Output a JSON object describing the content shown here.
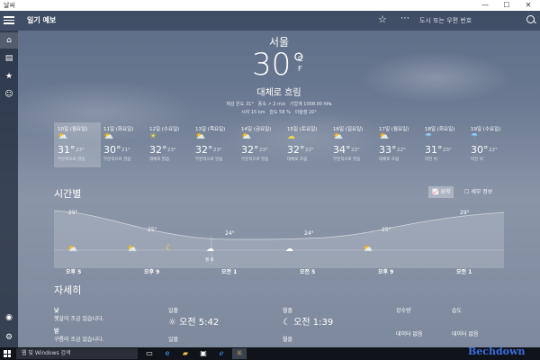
{
  "window": {
    "title": "날씨",
    "min": "—",
    "max": "☐",
    "close": "✕"
  },
  "app": {
    "title": "일기 예보",
    "search_placeholder": "도시 또는 우편 번호"
  },
  "current": {
    "city": "서울",
    "temp": "30°",
    "unit_c": "C",
    "unit_f": "F",
    "condition": "대체로 흐림",
    "feels": "체감 온도 31°",
    "wind": "풍속 ↗ 2 m/s",
    "pressure": "기압계 1008.00 hPa",
    "visibility": "시야 15 km",
    "humidity": "습도 58 %",
    "dew": "이슬점 20°"
  },
  "days": [
    {
      "d": "10일 (월요일)",
      "hi": "31°",
      "lo": "23°",
      "c": "부분적으로 맑음",
      "icon": "partly-sunny"
    },
    {
      "d": "11일 (화요일)",
      "hi": "30°",
      "lo": "21°",
      "c": "부분적으로 맑음",
      "icon": "partly-sunny"
    },
    {
      "d": "12일 (수요일)",
      "hi": "32°",
      "lo": "23°",
      "c": "대체로 맑음",
      "icon": "sunny"
    },
    {
      "d": "13일 (목요일)",
      "hi": "32°",
      "lo": "23°",
      "c": "부분적으로 맑음",
      "icon": "partly-sunny"
    },
    {
      "d": "14일 (금요일)",
      "hi": "32°",
      "lo": "23°",
      "c": "부분적으로 맑음",
      "icon": "partly-sunny"
    },
    {
      "d": "15일 (토요일)",
      "hi": "32°",
      "lo": "22°",
      "c": "대체로 흐림",
      "icon": "cloudy"
    },
    {
      "d": "16일 (일요일)",
      "hi": "34°",
      "lo": "22°",
      "c": "부분적으로 맑음",
      "icon": "partly-sunny"
    },
    {
      "d": "17일 (월요일)",
      "hi": "33°",
      "lo": "22°",
      "c": "대체로 흐림",
      "icon": "partly-sunny"
    },
    {
      "d": "18일 (화요일)",
      "hi": "31°",
      "lo": "23°",
      "c": "약한 비",
      "icon": "rain"
    },
    {
      "d": "19일 (수요일)",
      "hi": "30°",
      "lo": "22°",
      "c": "약한 비",
      "icon": "rain"
    }
  ],
  "hourly": {
    "title": "시간별",
    "btn_summary": "요약",
    "btn_detail": "세부 정보",
    "temps": [
      "29°",
      "25°",
      "24°",
      "24°",
      "25°",
      "29°"
    ],
    "labels": [
      "오후 5",
      "오후 9",
      "오전 1",
      "오전 5",
      "오후 9",
      "오전 1"
    ],
    "marker": "월 화"
  },
  "details": {
    "title": "자세히",
    "day_label": "낮",
    "day_text": "햇살이 조금 있습니다.",
    "night_label": "밤",
    "night_text": "구름이 조금 있습니다.",
    "sunrise_label": "일출",
    "sunrise": "오전 5:42",
    "moonrise_label": "월출",
    "moonrise": "오전 1:39",
    "sunset_label": "일몰",
    "moonset_label": "월몰",
    "precip_label": "강수량",
    "precip": "데이터 없음",
    "snow_label": "습도",
    "snow": "데이터 없음"
  },
  "taskbar": {
    "search": "웹 및 Windows 검색"
  },
  "watermark": "Bechdown",
  "colors": {
    "accent": "#f5d64a",
    "taskbar": "#10131a"
  }
}
